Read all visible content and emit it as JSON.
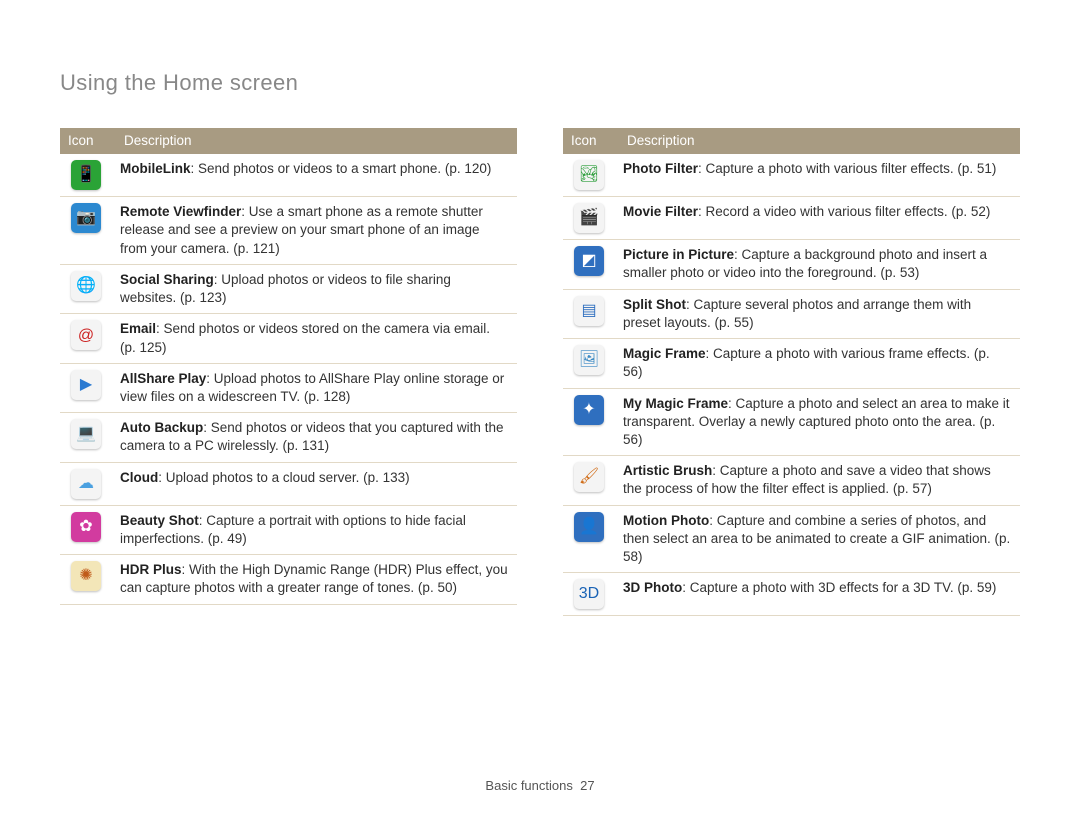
{
  "page": {
    "title": "Using the Home screen",
    "footer_section": "Basic functions",
    "footer_page": "27"
  },
  "table_headers": {
    "icon": "Icon",
    "description": "Description"
  },
  "left": [
    {
      "icon": "c-green",
      "name": "mobilelink-icon",
      "glyph": "📱",
      "title": "MobileLink",
      "desc": ": Send photos or videos to a smart phone. (p. 120)"
    },
    {
      "icon": "c-blue",
      "name": "remote-viewfinder-icon",
      "glyph": "📷",
      "title": "Remote Viewfinder",
      "desc": ": Use a smart phone as a remote shutter release and see a preview on your smart phone of an image from your camera. (p. 121)"
    },
    {
      "icon": "c-globe",
      "name": "social-sharing-icon",
      "glyph": "🌐",
      "title": "Social Sharing",
      "desc": ": Upload photos or videos to file sharing websites. (p. 123)"
    },
    {
      "icon": "c-red",
      "name": "email-icon",
      "glyph": "@",
      "title": "Email",
      "desc": ": Send photos or videos stored on the camera via email. (p. 125)"
    },
    {
      "icon": "c-play",
      "name": "allshare-play-icon",
      "glyph": "▶",
      "title": "AllShare Play",
      "desc": ": Upload photos to AllShare Play online storage or view files on a widescreen TV. (p. 128)"
    },
    {
      "icon": "c-laptop",
      "name": "auto-backup-icon",
      "glyph": "💻",
      "title": "Auto Backup",
      "desc": ": Send photos or videos that you captured with the camera to a PC wirelessly. (p. 131)"
    },
    {
      "icon": "c-cloud",
      "name": "cloud-icon",
      "glyph": "☁",
      "title": "Cloud",
      "desc": ": Upload photos to a cloud server. (p. 133)"
    },
    {
      "icon": "c-pink",
      "name": "beauty-shot-icon",
      "glyph": "✿",
      "title": "Beauty Shot",
      "desc": ": Capture a portrait with options to hide facial imperfections. (p. 49)"
    },
    {
      "icon": "c-hdr",
      "name": "hdr-plus-icon",
      "glyph": "✺",
      "title": "HDR Plus",
      "desc": ": With the High Dynamic Range (HDR) Plus effect, you can capture photos with a greater range of tones. (p. 50)"
    }
  ],
  "right": [
    {
      "icon": "c-filter",
      "name": "photo-filter-icon",
      "glyph": "🏞",
      "title": "Photo Filter",
      "desc": ": Capture a photo with various filter effects. (p. 51)"
    },
    {
      "icon": "c-movie",
      "name": "movie-filter-icon",
      "glyph": "🎬",
      "title": "Movie Filter",
      "desc": ": Record a video with various filter effects. (p. 52)"
    },
    {
      "icon": "c-pip",
      "name": "picture-in-picture-icon",
      "glyph": "◩",
      "title": "Picture in Picture",
      "desc": ": Capture a background photo and insert a smaller photo or video into the foreground. (p. 53)"
    },
    {
      "icon": "c-split",
      "name": "split-shot-icon",
      "glyph": "▤",
      "title": "Split Shot",
      "desc": ": Capture several photos and arrange them with preset layouts. (p. 55)"
    },
    {
      "icon": "c-frame",
      "name": "magic-frame-icon",
      "glyph": "🖼",
      "title": "Magic Frame",
      "desc": ": Capture a photo with various frame effects. (p. 56)"
    },
    {
      "icon": "c-magic",
      "name": "my-magic-frame-icon",
      "glyph": "✦",
      "title": "My Magic Frame",
      "desc": ": Capture a photo and select an area to make it transparent. Overlay a newly captured photo onto the area. (p. 56)"
    },
    {
      "icon": "c-brush",
      "name": "artistic-brush-icon",
      "glyph": "🖌",
      "title": "Artistic Brush",
      "desc": ": Capture a photo and save a video that shows the process of how the filter effect is applied. (p. 57)"
    },
    {
      "icon": "c-motion",
      "name": "motion-photo-icon",
      "glyph": "👤",
      "title": "Motion Photo",
      "desc": ": Capture and combine a series of photos, and then select an area to be animated to create a GIF animation. (p. 58)"
    },
    {
      "icon": "c-3d",
      "name": "three-d-photo-icon",
      "glyph": "3D",
      "title": "3D Photo",
      "desc": ": Capture a photo with 3D effects for a 3D TV. (p. 59)"
    }
  ]
}
